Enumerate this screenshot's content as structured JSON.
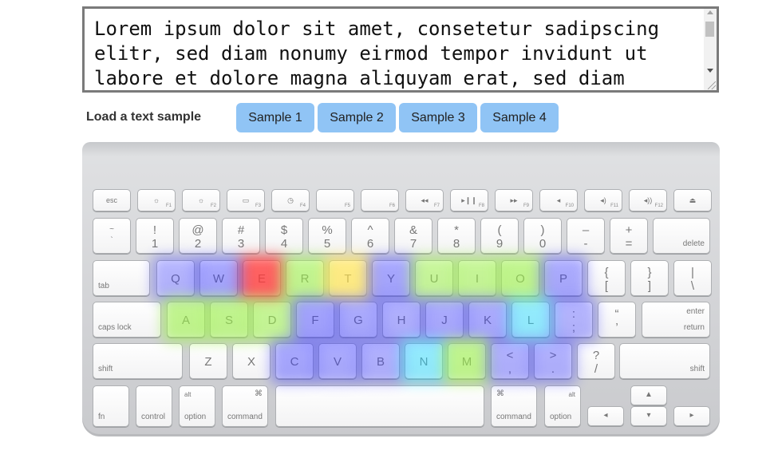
{
  "textarea": {
    "text": "Lorem ipsum dolor sit amet, consetetur sadipscing\nelitr, sed diam nonumy eirmod tempor invidunt ut\nlabore et dolore magna aliquyam erat, sed diam"
  },
  "samples": {
    "label": "Load a text sample",
    "buttons": [
      "Sample 1",
      "Sample 2",
      "Sample 3",
      "Sample 4"
    ]
  },
  "keyboard": {
    "fn_row": [
      {
        "label": "esc",
        "sub": ""
      },
      {
        "label": "☼",
        "sub": "F1"
      },
      {
        "label": "☼",
        "sub": "F2"
      },
      {
        "label": "▭",
        "sub": "F3"
      },
      {
        "label": "◷",
        "sub": "F4"
      },
      {
        "label": "",
        "sub": "F5"
      },
      {
        "label": "",
        "sub": "F6"
      },
      {
        "label": "◂◂",
        "sub": "F7"
      },
      {
        "label": "▸❙❙",
        "sub": "F8"
      },
      {
        "label": "▸▸",
        "sub": "F9"
      },
      {
        "label": "◂",
        "sub": "F10"
      },
      {
        "label": "◂)",
        "sub": "F11"
      },
      {
        "label": "◂))",
        "sub": "F12"
      },
      {
        "label": "⏏",
        "sub": ""
      }
    ],
    "number_row": [
      {
        "top": "~",
        "bottom": "`"
      },
      {
        "top": "!",
        "bottom": "1"
      },
      {
        "top": "@",
        "bottom": "2"
      },
      {
        "top": "#",
        "bottom": "3"
      },
      {
        "top": "$",
        "bottom": "4"
      },
      {
        "top": "%",
        "bottom": "5"
      },
      {
        "top": "^",
        "bottom": "6"
      },
      {
        "top": "&",
        "bottom": "7"
      },
      {
        "top": "*",
        "bottom": "8"
      },
      {
        "top": "(",
        "bottom": "9"
      },
      {
        "top": ")",
        "bottom": "0"
      },
      {
        "top": "–",
        "bottom": "-"
      },
      {
        "top": "+",
        "bottom": "="
      }
    ],
    "delete_label": "delete",
    "tab_label": "tab",
    "qwerty_row": [
      "Q",
      "W",
      "E",
      "R",
      "T",
      "Y",
      "U",
      "I",
      "O",
      "P"
    ],
    "bracket_keys": [
      {
        "top": "{",
        "bottom": "["
      },
      {
        "top": "}",
        "bottom": "]"
      },
      {
        "top": "|",
        "bottom": "\\"
      }
    ],
    "caps_label": "caps lock",
    "home_row": [
      "A",
      "S",
      "D",
      "F",
      "G",
      "H",
      "J",
      "K",
      "L"
    ],
    "home_punct": [
      {
        "top": ":",
        "bottom": ";"
      },
      {
        "top": "“",
        "bottom": "’"
      }
    ],
    "enter_top": "enter",
    "enter_bottom": "return",
    "shift_label": "shift",
    "bottom_row": [
      "Z",
      "X",
      "C",
      "V",
      "B",
      "N",
      "M"
    ],
    "bottom_punct": [
      {
        "top": "<",
        "bottom": ","
      },
      {
        "top": ">",
        "bottom": "."
      },
      {
        "top": "?",
        "bottom": "/"
      }
    ],
    "fn_label": "fn",
    "control_label": "control",
    "alt_label": "alt",
    "option_label": "option",
    "command_symbol": "⌘",
    "command_label": "command",
    "arrows": {
      "up": "▲",
      "left": "◂",
      "down": "▾",
      "right": "▸"
    }
  },
  "heatmap": {
    "scale": [
      "#3a3aff",
      "#22d8ff",
      "#9cf04a",
      "#ffe24a",
      "#ff3b3b"
    ],
    "key_intensity": {
      "E": 1.0,
      "R": 0.55,
      "T": 0.7,
      "Y": 0.2,
      "U": 0.45,
      "I": 0.5,
      "O": 0.6,
      "P": 0.15,
      "W": 0.2,
      "Q": 0.05,
      "A": 0.6,
      "S": 0.6,
      "D": 0.5,
      "F": 0.25,
      "G": 0.15,
      "H": 0.1,
      "J": 0.15,
      "K": 0.15,
      "L": 0.3,
      ";": 0.05,
      "C": 0.2,
      "V": 0.15,
      "B": 0.1,
      "N": 0.3,
      "M": 0.6,
      ",": 0.1,
      ".": 0.1
    }
  }
}
